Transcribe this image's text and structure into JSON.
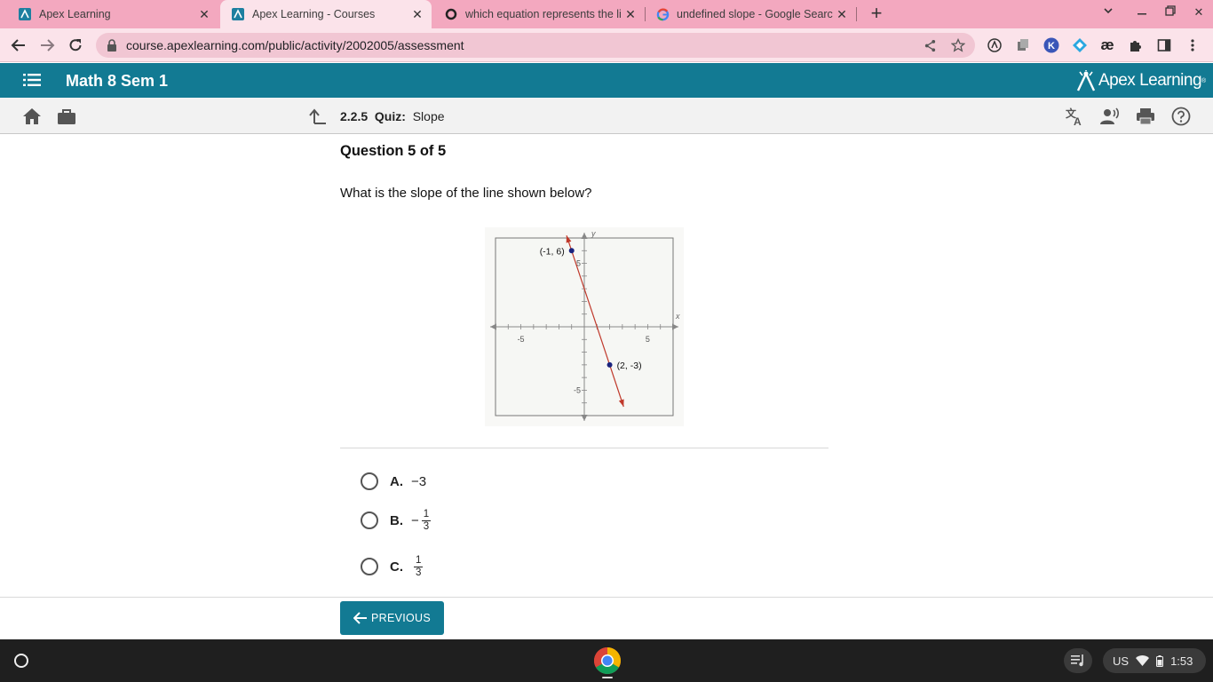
{
  "browser": {
    "tabs": [
      {
        "title": "Apex Learning",
        "active": false
      },
      {
        "title": "Apex Learning - Courses",
        "active": true
      },
      {
        "title": "which equation represents the li",
        "active": false
      },
      {
        "title": "undefined slope - Google Search",
        "active": false
      }
    ],
    "url": "course.apexlearning.com/public/activity/2002005/assessment",
    "new_tab": "+"
  },
  "app": {
    "course_title": "Math 8 Sem 1",
    "brand": "Apex Learning",
    "brand_mark": "®"
  },
  "activity": {
    "number": "2.2.5",
    "type": "Quiz:",
    "name": "Slope"
  },
  "question": {
    "header": "Question 5 of 5",
    "text": "What is the slope of the line shown below?"
  },
  "graph": {
    "x_axis_label": "x",
    "y_axis_label": "y",
    "tick_neg5": "-5",
    "tick_pos5": "5",
    "point_a_label": "(-1, 6)",
    "point_b_label": "(2, -3)",
    "point_a": [
      -1,
      6
    ],
    "point_b": [
      2,
      -3
    ],
    "range": [
      -7,
      7
    ],
    "line_color": "#c0392b",
    "point_color": "#1a237e"
  },
  "choices": [
    {
      "letter": "A.",
      "sign": "−3"
    },
    {
      "letter": "B.",
      "sign": "−",
      "num": "1",
      "den": "3"
    },
    {
      "letter": "C.",
      "num": "1",
      "den": "3"
    }
  ],
  "footer": {
    "previous_label": "PREVIOUS"
  },
  "shelf": {
    "locale": "US",
    "time": "1:53"
  },
  "colors": {
    "apex_teal": "#127a93",
    "tabstrip": "#f3a8bf",
    "toolbar": "#fbe3ea"
  }
}
